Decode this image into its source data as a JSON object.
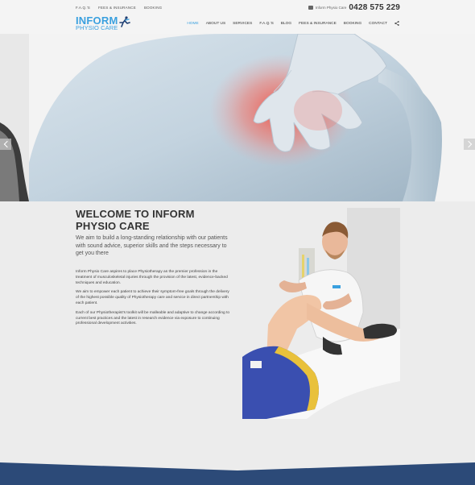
{
  "topbar": {
    "links": [
      "F.A.Q.'S",
      "FEES & INSURANCE",
      "BOOKING"
    ],
    "phone_label": "Inform Physio Care",
    "phone_number": "0428 575 229"
  },
  "logo": {
    "line1": "INFORM",
    "line2": "PHYSIO CARE"
  },
  "nav": {
    "items": [
      "HOME",
      "ABOUT US",
      "SERVICES",
      "F.A.Q.'S",
      "BLOG",
      "FEES & INSURANCE",
      "BOOKING",
      "CONTACT"
    ],
    "active": "HOME"
  },
  "welcome": {
    "title": "WELCOME TO INFORM PHYSIO CARE",
    "intro": "We aim to build a long-standing relationship with our patients with sound advice, superior skills and the steps necessary to get you there",
    "paragraphs": [
      "Inform Physio Care aspires to place Physiotherapy as the premier profession in the treatment of musculoskeletal injuries through the provision of the latest, evidence-backed techniques and education.",
      "We aim to empower each patient to achieve their symptom-free goals through the delivery of the highest possible quality of Physiotherapy care and service in direct partnership with each patient.",
      "Each of our Physiotherapist's toolkit will be malleable and adaptive to change according to current best practices and the latest in research evidence via exposure to continuing professional development activities."
    ]
  },
  "colors": {
    "accent": "#3aa0df",
    "footer": "#2c4a78",
    "background": "#ececec"
  },
  "icons": {
    "phone": "phone-icon",
    "share": "share-icon",
    "slider_prev": "chevron-left-icon",
    "slider_next": "chevron-right-icon"
  }
}
